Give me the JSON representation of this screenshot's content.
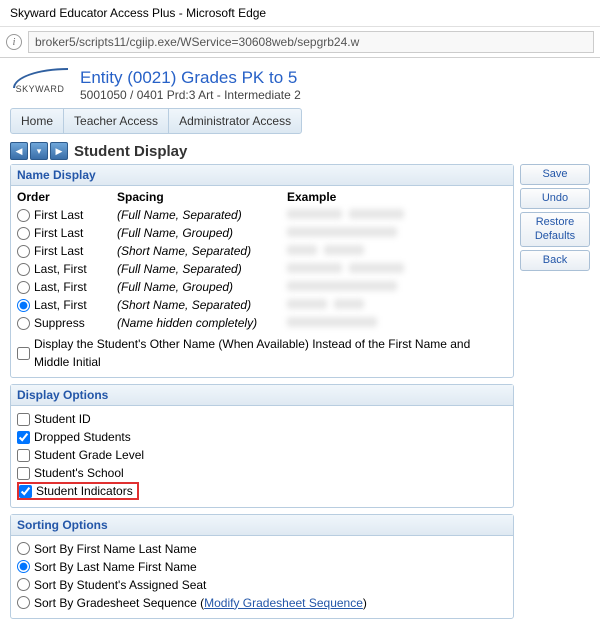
{
  "window": {
    "title": "Skyward Educator Access Plus - Microsoft Edge"
  },
  "address": {
    "url": "broker5/scripts11/cgiip.exe/WService=30608web/sepgrb24.w"
  },
  "logo": {
    "text": "SKYWARD"
  },
  "header": {
    "entity": "Entity (0021) Grades PK to 5",
    "subtitle": "5001050 / 0401 Prd:3 Art - Intermediate 2"
  },
  "tabs": {
    "home": "Home",
    "teacher": "Teacher Access",
    "admin": "Administrator Access"
  },
  "page": {
    "title": "Student Display"
  },
  "sidebar": {
    "save": "Save",
    "undo": "Undo",
    "restore": "Restore Defaults",
    "back": "Back"
  },
  "name_display": {
    "title": "Name Display",
    "hdr_order": "Order",
    "hdr_spacing": "Spacing",
    "hdr_example": "Example",
    "rows": [
      {
        "order": "First Last",
        "spacing": "(Full Name, Separated)"
      },
      {
        "order": "First Last",
        "spacing": "(Full Name, Grouped)"
      },
      {
        "order": "First Last",
        "spacing": "(Short Name, Separated)"
      },
      {
        "order": "Last, First",
        "spacing": "(Full Name, Separated)"
      },
      {
        "order": "Last, First",
        "spacing": "(Full Name, Grouped)"
      },
      {
        "order": "Last, First",
        "spacing": "(Short Name, Separated)"
      },
      {
        "order": "Suppress",
        "spacing": "(Name hidden completely)"
      }
    ],
    "other_name": "Display the Student's Other Name (When Available) Instead of the First Name and Middle Initial"
  },
  "display_options": {
    "title": "Display Options",
    "student_id": "Student ID",
    "dropped": "Dropped Students",
    "grade_level": "Student Grade Level",
    "school": "Student's School",
    "indicators": "Student Indicators"
  },
  "sorting_options": {
    "title": "Sorting Options",
    "first_last": "Sort By First Name Last Name",
    "last_first": "Sort By Last Name First Name",
    "seat": "Sort By Student's Assigned Seat",
    "gradesheet": "Sort By Gradesheet Sequence",
    "modify_link": "Modify Gradesheet Sequence"
  }
}
